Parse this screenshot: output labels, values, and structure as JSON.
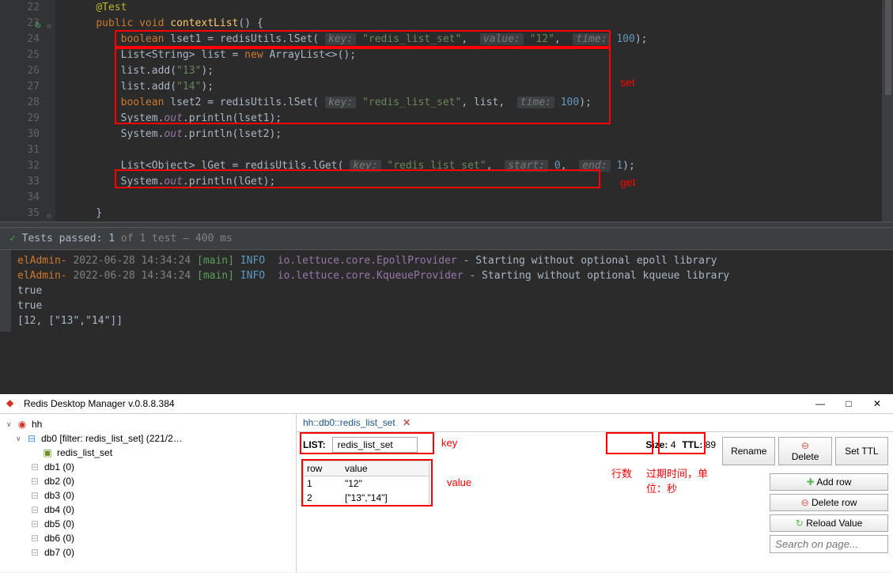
{
  "editor": {
    "lines": {
      "22": 22,
      "23": 23,
      "24": 24,
      "25": 25,
      "26": 26,
      "27": 27,
      "28": 28,
      "29": 29,
      "30": 30,
      "31": 31,
      "32": 32,
      "33": 33,
      "34": 34,
      "35": 35
    },
    "code": {
      "l22": "@Test",
      "l23_public": "public",
      "l23_void": "void",
      "l23_method": "contextList",
      "l23_rest": "() {",
      "l24_boolean": "boolean",
      "l24_var": " lset1 = redisUtils.",
      "l24_m": "lSet",
      "l24_p1": "key:",
      "l24_v1": "\"redis_list_set\"",
      "l24_p2": "value:",
      "l24_v2": "\"12\"",
      "l24_p3": "time:",
      "l24_v3": "100",
      "l24_end": ");",
      "l25": "List<String> list = ",
      "l25_new": "new",
      "l25_rest": " ArrayList<>();",
      "l26": "list.add(",
      "l26_v": "\"13\"",
      "l26_end": ");",
      "l27": "list.add(",
      "l27_v": "\"14\"",
      "l27_end": ");",
      "l28_boolean": "boolean",
      "l28_var": " lset2 = redisUtils.",
      "l28_m": "lSet",
      "l28_p1": "key:",
      "l28_v1": "\"redis_list_set\"",
      "l28_list": ", list, ",
      "l28_p3": "time:",
      "l28_v3": "100",
      "l28_end": ");",
      "l29": "System.",
      "l29_out": "out",
      "l29_rest": ".println(lset1);",
      "l30": "System.",
      "l30_out": "out",
      "l30_rest": ".println(lset2);",
      "l32_list": "List<Object> lGet = redisUtils.",
      "l32_m": "lGet",
      "l32_p1": "key:",
      "l32_v1": "\"redis_list_set\"",
      "l32_p2": "start:",
      "l32_v2": "0",
      "l32_p3": "end:",
      "l32_v3": "1",
      "l32_end": ");",
      "l33": "System.",
      "l33_out": "out",
      "l33_rest": ".println(lGet);",
      "l35": "}"
    },
    "annotations": {
      "set": "set",
      "get": "get"
    }
  },
  "test_bar": {
    "check": "✓",
    "prefix": "Tests passed:",
    "count": "1",
    "mid": "of 1 test",
    "time": "– 400 ms"
  },
  "console": {
    "l1_prefix": "elAdmin-",
    "l1_time": " 2022-06-28 14:34:24 ",
    "l1_main": "[main]",
    "l1_level": " INFO ",
    "l1_class": " io.lettuce.core.EpollProvider",
    "l1_msg": " - Starting without optional epoll library",
    "l2_prefix": "elAdmin-",
    "l2_time": " 2022-06-28 14:34:24 ",
    "l2_main": "[main]",
    "l2_level": " INFO ",
    "l2_class": " io.lettuce.core.KqueueProvider",
    "l2_msg": " - Starting without optional kqueue library",
    "l3": "true",
    "l4": "true",
    "l5": "[12, [\"13\",\"14\"]]"
  },
  "rdm": {
    "title": "Redis Desktop Manager v.0.8.8.384",
    "tree": {
      "root": "hh",
      "db0": "db0 [filter: redis_list_set] (221/2…",
      "key": "redis_list_set",
      "db1": "db1 (0)",
      "db2": "db2 (0)",
      "db3": "db3 (0)",
      "db4": "db4 (0)",
      "db5": "db5 (0)",
      "db6": "db6 (0)",
      "db7": "db7 (0)"
    },
    "tab": "hh::db0::redis_list_set",
    "info": {
      "type_label": "LIST:",
      "key_value": "redis_list_set",
      "size_label": "Size:",
      "size_value": "4",
      "ttl_label": "TTL:",
      "ttl_value": "89"
    },
    "buttons": {
      "rename": "Rename",
      "delete": "Delete",
      "set_ttl": "Set TTL",
      "add_row": "Add row",
      "delete_row": "Delete row",
      "reload": "Reload Value"
    },
    "table": {
      "col_row": "row",
      "col_value": "value",
      "r1_row": "1",
      "r1_val": "\"12\"",
      "r2_row": "2",
      "r2_val": "[\"13\",\"14\"]"
    },
    "search_placeholder": "Search on page...",
    "annotations": {
      "key": "key",
      "value": "value",
      "rows": "行数",
      "ttl": "过期时间，单位：秒"
    }
  }
}
